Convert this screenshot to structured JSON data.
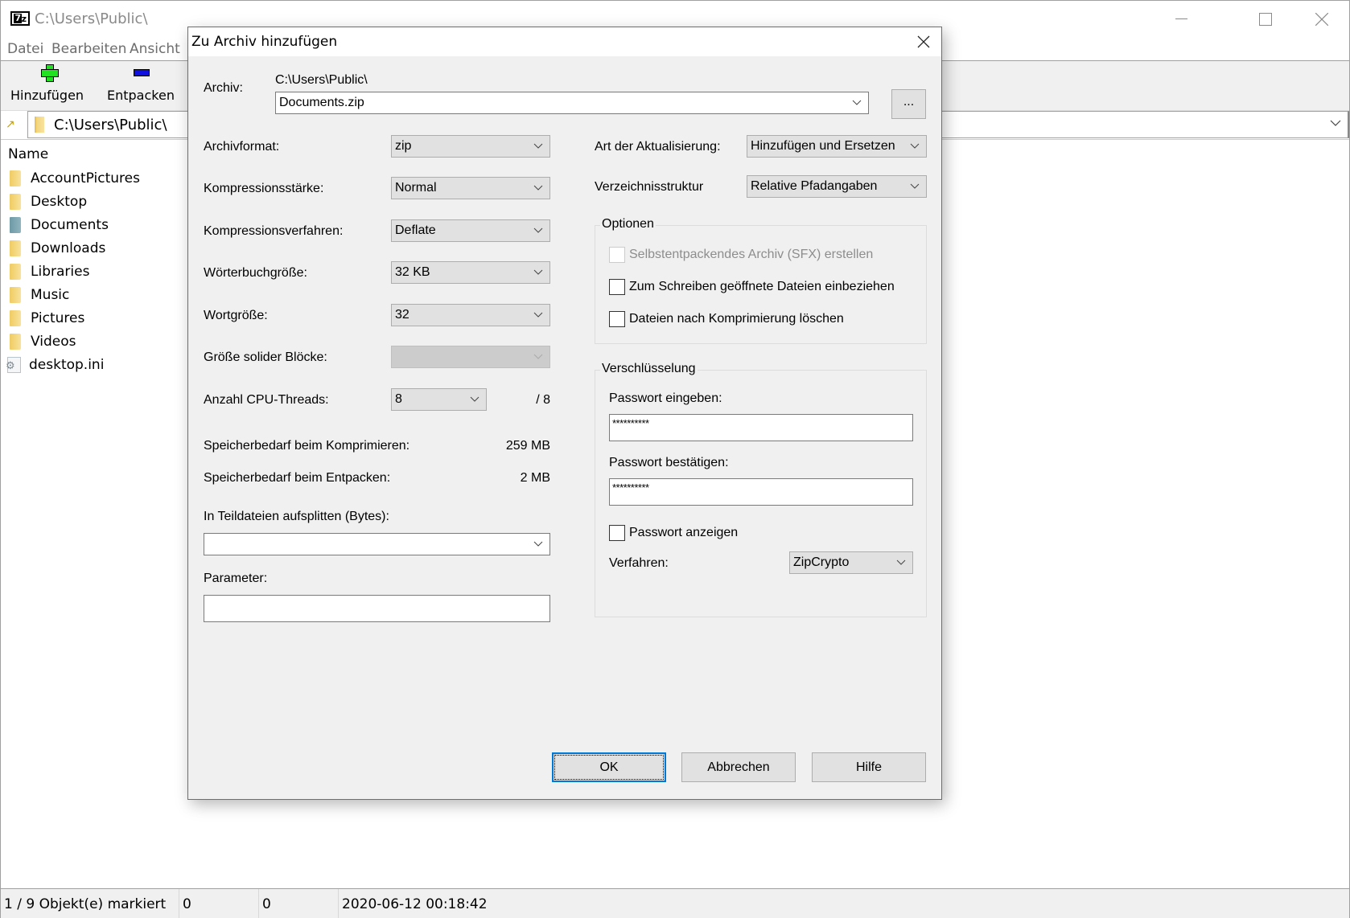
{
  "main_window": {
    "title": "C:\\Users\\Public\\",
    "menu": [
      "Datei",
      "Bearbeiten",
      "Ansicht"
    ],
    "toolbar": {
      "add_label": "Hinzufügen",
      "extract_label": "Entpacken"
    },
    "address": "C:\\Users\\Public\\",
    "list": {
      "column_name": "Name",
      "items": [
        {
          "name": "AccountPictures",
          "icon": "folder-icon"
        },
        {
          "name": "Desktop",
          "icon": "folder-icon"
        },
        {
          "name": "Documents",
          "icon": "documents-folder-icon"
        },
        {
          "name": "Downloads",
          "icon": "folder-icon"
        },
        {
          "name": "Libraries",
          "icon": "folder-icon"
        },
        {
          "name": "Music",
          "icon": "folder-icon"
        },
        {
          "name": "Pictures",
          "icon": "folder-icon"
        },
        {
          "name": "Videos",
          "icon": "folder-icon"
        },
        {
          "name": "desktop.ini",
          "icon": "settings-file-icon"
        }
      ]
    },
    "status": {
      "selection": "1 / 9 Objekt(e) markiert",
      "size": "0",
      "packed_size": "0",
      "modified": "2020-06-12 00:18:42"
    }
  },
  "dialog": {
    "title": "Zu Archiv hinzufügen",
    "archive_label": "Archiv:",
    "archive_path": "C:\\Users\\Public\\",
    "archive_name": "Documents.zip",
    "browse_label": "...",
    "left": {
      "format_label": "Archivformat:",
      "format_value": "zip",
      "level_label": "Kompressionsstärke:",
      "level_value": "Normal",
      "method_label": "Kompressionsverfahren:",
      "method_value": "Deflate",
      "dict_label": "Wörterbuchgröße:",
      "dict_value": "32 KB",
      "word_label": "Wortgröße:",
      "word_value": "32",
      "solid_label": "Größe solider Blöcke:",
      "solid_value": "",
      "threads_label": "Anzahl CPU-Threads:",
      "threads_value": "8",
      "threads_max": "/ 8",
      "mem_compress_label": "Speicherbedarf beim Komprimieren:",
      "mem_compress_value": "259 MB",
      "mem_extract_label": "Speicherbedarf beim Entpacken:",
      "mem_extract_value": "2 MB",
      "split_label": "In Teildateien aufsplitten (Bytes):",
      "split_value": "",
      "params_label": "Parameter:",
      "params_value": ""
    },
    "right": {
      "update_label": "Art der Aktualisierung:",
      "update_value": "Hinzufügen und Ersetzen",
      "paths_label": "Verzeichnisstruktur",
      "paths_value": "Relative Pfadangaben",
      "options_title": "Optionen",
      "opt_sfx": "Selbstentpackendes Archiv (SFX) erstellen",
      "opt_shared": "Zum Schreiben geöffnete Dateien einbeziehen",
      "opt_delete": "Dateien nach Komprimierung löschen",
      "enc_title": "Verschlüsselung",
      "pw_label": "Passwort eingeben:",
      "pw_value": "**********",
      "pw_confirm_label": "Passwort bestätigen:",
      "pw_confirm_value": "**********",
      "show_pw": "Passwort anzeigen",
      "enc_method_label": "Verfahren:",
      "enc_method_value": "ZipCrypto"
    },
    "buttons": {
      "ok": "OK",
      "cancel": "Abbrechen",
      "help": "Hilfe"
    }
  }
}
